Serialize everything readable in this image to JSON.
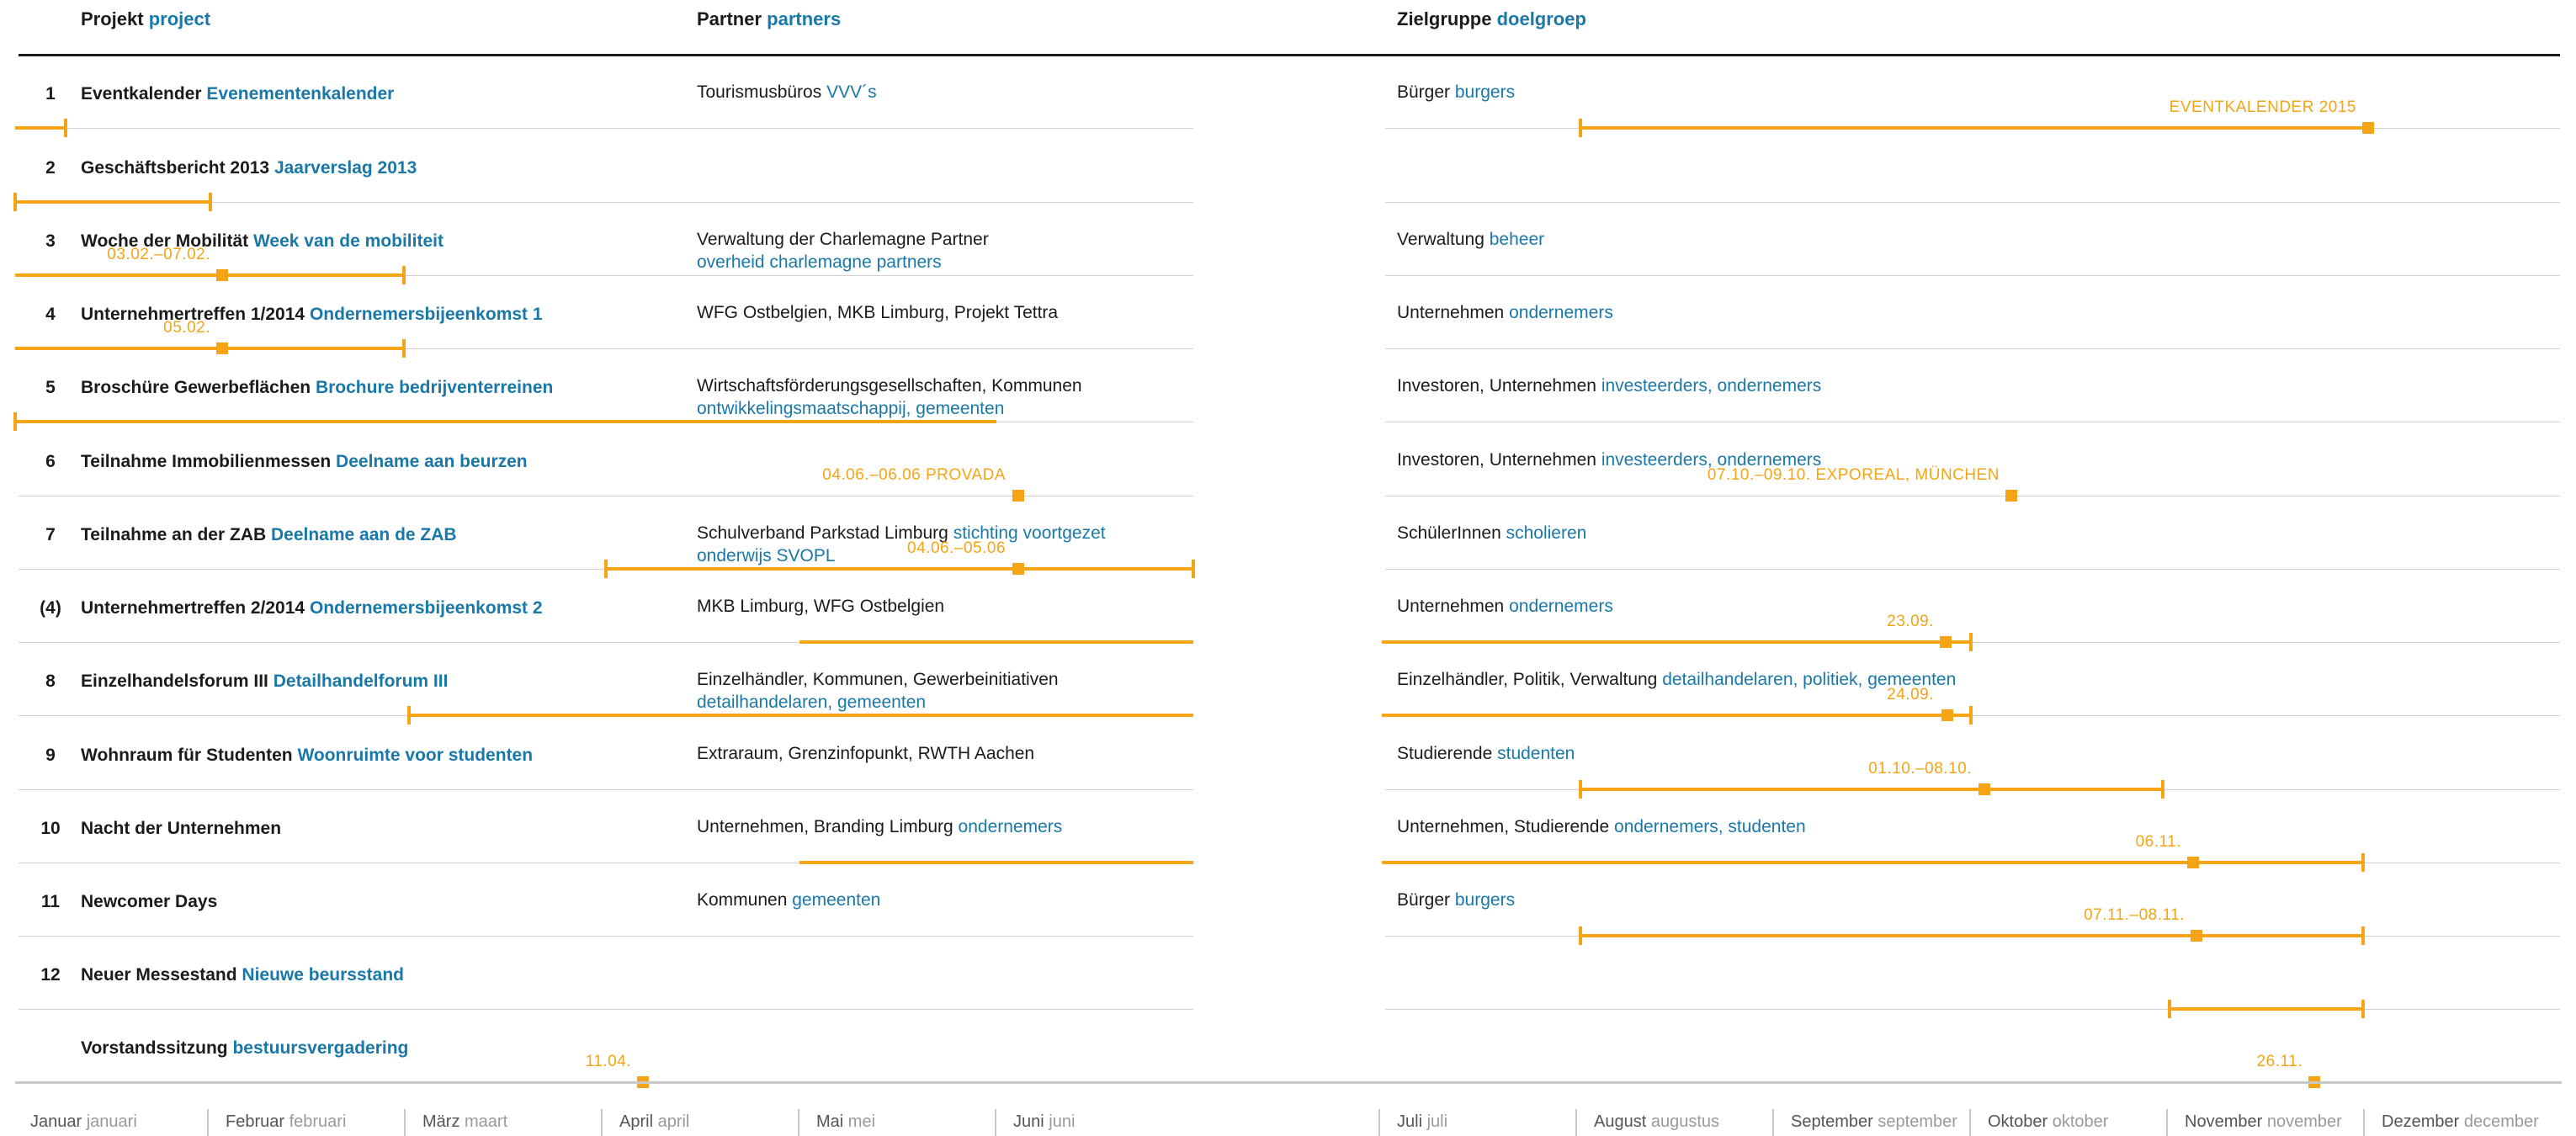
{
  "headers": {
    "project_de": "Projekt",
    "project_nl": "project",
    "partner_de": "Partner",
    "partner_nl": "partners",
    "target_de": "Zielgruppe",
    "target_nl": "doelgroep"
  },
  "rows": [
    {
      "num": "1",
      "project_de": "Eventkalender",
      "project_nl": "Evenementenkalender",
      "partner_de": "Tourismusbüros",
      "partner_nl": "VVV´s",
      "partner_line2": "",
      "target_de": "Bürger",
      "target_nl": "burgers",
      "label_a": "",
      "label_b": "EVENTKALENDER 2015"
    },
    {
      "num": "2",
      "project_de": "Geschäftsbericht 2013",
      "project_nl": "Jaarverslag 2013",
      "partner_de": "",
      "partner_nl": "",
      "partner_line2": "",
      "target_de": "",
      "target_nl": "",
      "label_a": "",
      "label_b": ""
    },
    {
      "num": "3",
      "project_de": "Woche der Mobilität",
      "project_nl": "Week van de mobiliteit",
      "partner_de": "Verwaltung der Charlemagne Partner",
      "partner_nl": "",
      "partner_line2": "overheid charlemagne partners",
      "target_de": "Verwaltung",
      "target_nl": "beheer",
      "label_a": "03.02.–07.02.",
      "label_b": ""
    },
    {
      "num": "4",
      "project_de": "Unternehmertreffen 1/2014",
      "project_nl": "Ondernemersbijeenkomst 1",
      "partner_de": "WFG Ostbelgien, MKB Limburg, Projekt Tettra",
      "partner_nl": "",
      "partner_line2": "",
      "target_de": "Unternehmen",
      "target_nl": "ondernemers",
      "label_a": "05.02.",
      "label_b": ""
    },
    {
      "num": "5",
      "project_de": "Broschüre Gewerbeflächen",
      "project_nl": "Brochure bedrijventerreinen",
      "partner_de": "Wirtschaftsförderungsgesellschaften, Kommunen",
      "partner_nl": "",
      "partner_line2": "ontwikkelingsmaatschappij, gemeenten",
      "target_de": "Investoren, Unternehmen",
      "target_nl": "investeerders, ondernemers",
      "label_a": "",
      "label_b": ""
    },
    {
      "num": "6",
      "project_de": "Teilnahme Immobilienmessen",
      "project_nl": "Deelname aan beurzen",
      "partner_de": "",
      "partner_nl": "",
      "partner_line2": "",
      "target_de": "Investoren, Unternehmen",
      "target_nl": "investeerders, ondernemers",
      "label_a": "04.06.–06.06 PROVADA",
      "label_b": "07.10.–09.10. EXPOREAL, MÜNCHEN"
    },
    {
      "num": "7",
      "project_de": "Teilnahme an der ZAB",
      "project_nl": "Deelname aan de ZAB",
      "partner_de": "Schulverband Parkstad Limburg",
      "partner_nl": "stichting voortgezet",
      "partner_line2": "onderwijs SVOPL",
      "target_de": "SchülerInnen",
      "target_nl": "scholieren",
      "label_a": "04.06.–05.06",
      "label_b": ""
    },
    {
      "num": "(4)",
      "project_de": "Unternehmertreffen 2/2014",
      "project_nl": "Ondernemersbijeenkomst 2",
      "partner_de": "MKB Limburg, WFG Ostbelgien",
      "partner_nl": "",
      "partner_line2": "",
      "target_de": "Unternehmen",
      "target_nl": "ondernemers",
      "label_a": "",
      "label_b": "23.09."
    },
    {
      "num": "8",
      "project_de": "Einzelhandelsforum III",
      "project_nl": "Detailhandelforum III",
      "partner_de": "Einzelhändler, Kommunen, Gewerbeinitiativen",
      "partner_nl": "",
      "partner_line2": "detailhandelaren, gemeenten",
      "target_de": "Einzelhändler, Politik, Verwaltung",
      "target_nl": "detailhandelaren, politiek, gemeenten",
      "label_a": "",
      "label_b": "24.09."
    },
    {
      "num": "9",
      "project_de": "Wohnraum für Studenten",
      "project_nl": "Woonruimte voor studenten",
      "partner_de": "Extraraum, Grenzinfopunkt, RWTH Aachen",
      "partner_nl": "",
      "partner_line2": "",
      "target_de": "Studierende",
      "target_nl": "studenten",
      "label_a": "",
      "label_b": "01.10.–08.10."
    },
    {
      "num": "10",
      "project_de": "Nacht der Unternehmen",
      "project_nl": "",
      "partner_de": "Unternehmen, Branding Limburg",
      "partner_nl": "ondernemers",
      "partner_line2": "",
      "target_de": "Unternehmen, Studierende",
      "target_nl": "ondernemers, studenten",
      "label_a": "",
      "label_b": "06.11."
    },
    {
      "num": "11",
      "project_de": "Newcomer Days",
      "project_nl": "",
      "partner_de": "Kommunen",
      "partner_nl": "gemeenten",
      "partner_line2": "",
      "target_de": "Bürger",
      "target_nl": "burgers",
      "label_a": "",
      "label_b": "07.11.–08.11."
    },
    {
      "num": "12",
      "project_de": "Neuer Messestand",
      "project_nl": "Nieuwe beursstand",
      "partner_de": "",
      "partner_nl": "",
      "partner_line2": "",
      "target_de": "",
      "target_nl": "",
      "label_a": "",
      "label_b": ""
    },
    {
      "num": "",
      "project_de": "Vorstandssitzung",
      "project_nl": "bestuursvergadering",
      "partner_de": "",
      "partner_nl": "",
      "partner_line2": "",
      "target_de": "",
      "target_nl": "",
      "label_a": "11.04.",
      "label_b": "26.11."
    }
  ],
  "months": [
    {
      "de": "Januar",
      "nl": "januari"
    },
    {
      "de": "Februar",
      "nl": "februari"
    },
    {
      "de": "März",
      "nl": "maart"
    },
    {
      "de": "April",
      "nl": "april"
    },
    {
      "de": "Mai",
      "nl": "mei"
    },
    {
      "de": "Juni",
      "nl": "juni"
    },
    {
      "de": "Juli",
      "nl": "juli"
    },
    {
      "de": "August",
      "nl": "augustus"
    },
    {
      "de": "September",
      "nl": "september"
    },
    {
      "de": "Oktober",
      "nl": "oktober"
    },
    {
      "de": "November",
      "nl": "november"
    },
    {
      "de": "Dezember",
      "nl": "december"
    }
  ],
  "colors": {
    "accent": "#f5a416",
    "dutch": "#1a78a8",
    "text": "#1b1b1b",
    "rule": "#cfcfcf"
  }
}
